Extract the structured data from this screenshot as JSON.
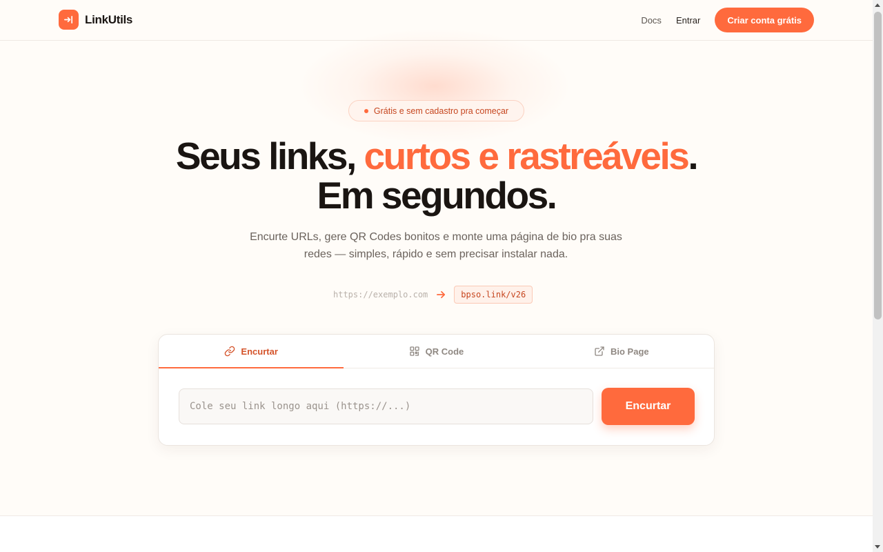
{
  "header": {
    "logo_text": "LinkUtils",
    "nav": [
      {
        "label": "Docs"
      },
      {
        "label": "Entrar"
      }
    ],
    "cta_label": "Criar conta grátis"
  },
  "badge": {
    "text": "Grátis e sem cadastro pra começar"
  },
  "hero": {
    "title_part1": "Seus links, ",
    "title_accent": "curtos e rastreáveis",
    "title_part2": ".",
    "title_line2": "Em segundos.",
    "subtitle_line1": "Encurte URLs, gere QR Codes bonitos e monte uma página de bio pra suas",
    "subtitle_line2": "redes — simples, rápido e sem precisar instalar nada."
  },
  "demo": {
    "source_url": "https://exemplo.com",
    "short_url": "bpso.link/v26"
  },
  "card": {
    "tabs": [
      {
        "label": "Encurtar",
        "icon": "link-icon",
        "active": true
      },
      {
        "label": "QR Code",
        "icon": "qr-icon",
        "active": false
      },
      {
        "label": "Bio Page",
        "icon": "external-link-icon",
        "active": false
      }
    ],
    "input_placeholder": "Cole seu link longo aqui (https://...)",
    "input_value": "",
    "submit_label": "Encurtar"
  },
  "colors": {
    "accent": "#ff6a3d",
    "background": "#fffcf8",
    "text": "#1a1512"
  }
}
